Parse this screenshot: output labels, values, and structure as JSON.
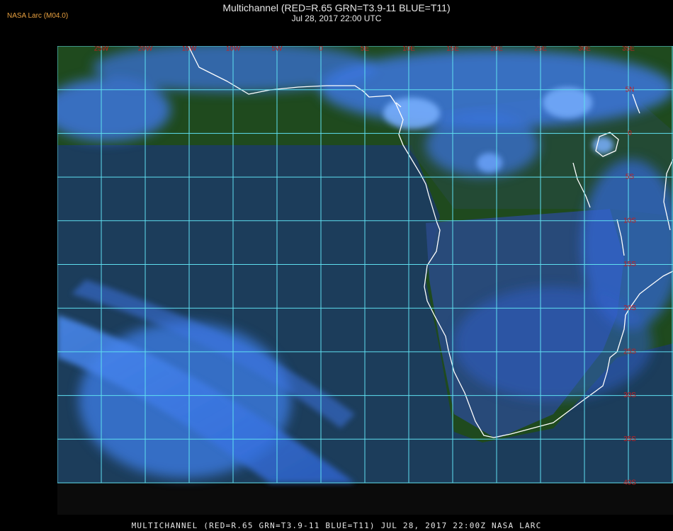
{
  "badge": "NASA Larc (M04.0)",
  "title": "Multichannel (RED=R.65 GRN=T3.9-11 BLUE=T11)",
  "subtitle": "Jul 28, 2017 22:00 UTC",
  "footer": "MULTICHANNEL (RED=R.65 GRN=T3.9-11 BLUE=T11) JUL 28, 2017 22:00Z  NASA LARC",
  "map": {
    "lon_labels": [
      "25W",
      "20W",
      "15W",
      "10W",
      "5W",
      "0",
      "5E",
      "10E",
      "15E",
      "20E",
      "25E",
      "30E",
      "35E"
    ],
    "lat_labels": [
      "5N",
      "0",
      "5S",
      "10S",
      "15S",
      "20S",
      "25S",
      "30S",
      "35S",
      "40S"
    ],
    "colors": {
      "grid": "#5fe0f0",
      "label": "#c81e1e",
      "coast": "#ffffff",
      "land": "#1e4a1c",
      "ocean": "#1a3a6a",
      "cloud": "#3a72e6",
      "cloud_bright": "#78b0ff"
    }
  }
}
